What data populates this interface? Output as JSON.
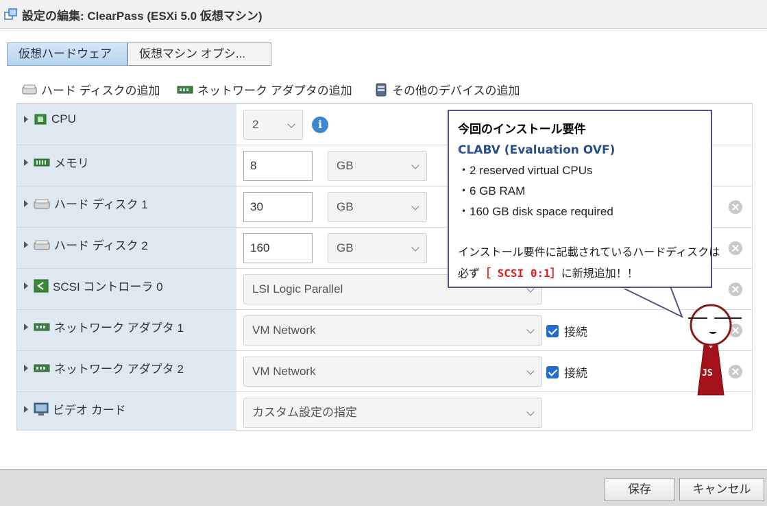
{
  "window": {
    "title": "設定の編集: ClearPass (ESXi 5.0 仮想マシン)"
  },
  "tabs": [
    {
      "label": "仮想ハードウェア"
    },
    {
      "label": "仮想マシン オプシ..."
    }
  ],
  "toolbar": {
    "add_disk": "ハード ディスクの追加",
    "add_nic": "ネットワーク アダプタの追加",
    "add_other": "その他のデバイスの追加"
  },
  "hardware": {
    "cpu": {
      "label": "CPU",
      "value": "2"
    },
    "memory": {
      "label": "メモリ",
      "value": "8",
      "unit": "GB"
    },
    "disk1": {
      "label": "ハード ディスク 1",
      "value": "30",
      "unit": "GB"
    },
    "disk2": {
      "label": "ハード ディスク 2",
      "value": "160",
      "unit": "GB"
    },
    "scsi": {
      "label": "SCSI コントローラ 0",
      "value": "LSI Logic Parallel"
    },
    "nic1": {
      "label": "ネットワーク アダプタ 1",
      "value": "VM Network",
      "connect": "接続"
    },
    "nic2": {
      "label": "ネットワーク アダプタ 2",
      "value": "VM Network",
      "connect": "接続"
    },
    "video": {
      "label": "ビデオ カード",
      "value": "カスタム設定の指定"
    }
  },
  "callout": {
    "title": "今回のインストール要件",
    "subtitle": "CLABV (Evaluation OVF)",
    "items": [
      "・2 reserved virtual CPUs",
      "・6 GB RAM",
      "・160 GB disk space required"
    ],
    "note": "インストール要件に記載されているハードディスクは",
    "must_prefix": "必ず",
    "must_highlight": "［ SCSI 0:1］",
    "must_suffix": "に新規追加！！"
  },
  "mascot": {
    "badge": "JS"
  },
  "footer": {
    "save": "保存",
    "cancel": "キャンセル"
  },
  "colors": {
    "tab_active": "#c4dcf2",
    "left_column": "#dde8f1",
    "callout_border": "#5e4a86",
    "highlight_red": "#e01d1d",
    "mascot_red": "#a3111a"
  }
}
